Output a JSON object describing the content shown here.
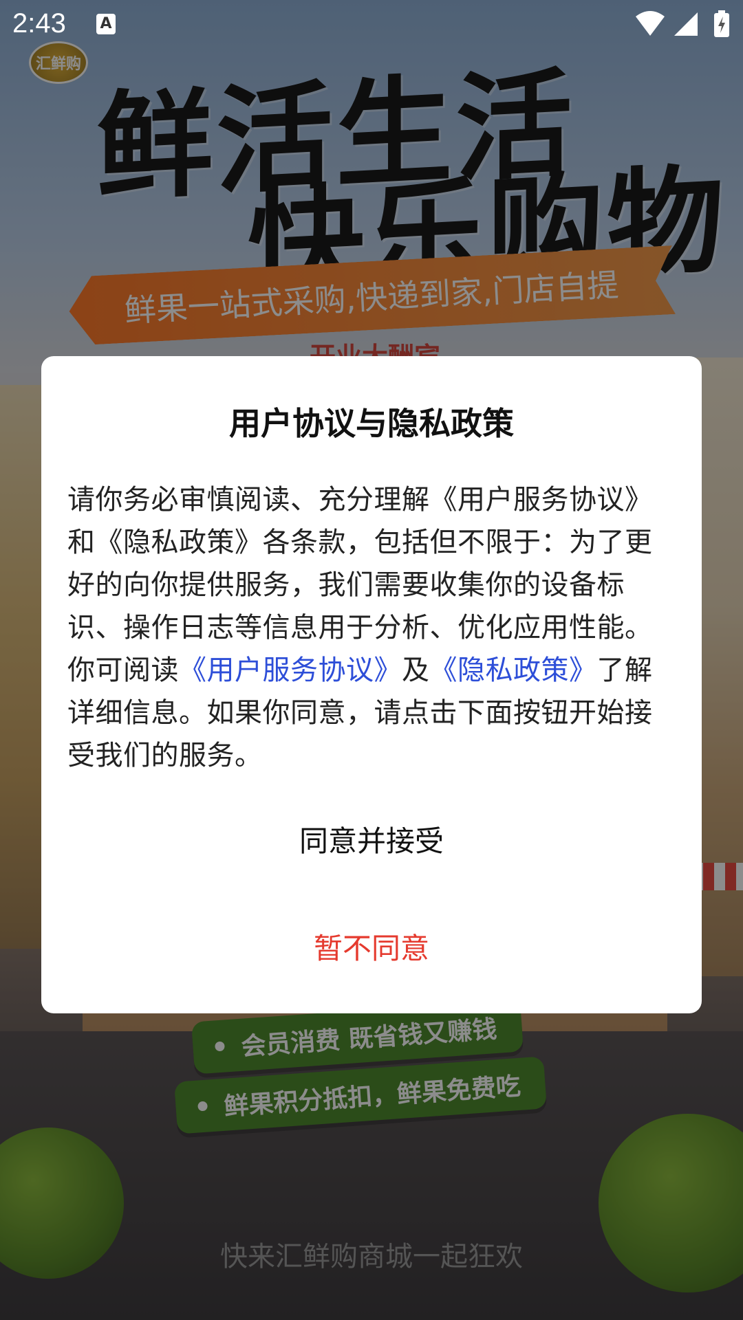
{
  "status_bar": {
    "time": "2:43",
    "notification_icon": "a-text-icon",
    "icons": [
      "wifi-icon",
      "cellular-signal-icon",
      "battery-charging-icon"
    ]
  },
  "splash": {
    "logo_text": "汇鲜购",
    "headline_1": "鲜活生活",
    "headline_2": "快乐购物",
    "ribbon": "鲜果一站式采购,快递到家,门店自提",
    "opening_tag": "开业大酬宾",
    "pill_1": "会员消费 既省钱又赚钱",
    "pill_2": "鲜果积分抵扣，鲜果免费吃",
    "bottom_slogan": "快来汇鲜购商城一起狂欢"
  },
  "dialog": {
    "title": "用户协议与隐私政策",
    "body_part1": "请你务必审慎阅读、充分理解《用户服务协议》和《隐私政策》各条款，包括但不限于：为了更好的向你提供服务，我们需要收集你的设备标识、操作日志等信息用于分析、优化应用性能。你可阅读",
    "link_terms": "《用户服务协议》",
    "body_and": "及",
    "link_privacy": "《隐私政策》",
    "body_part2": "了解详细信息。如果你同意，请点击下面按钮开始接受我们的服务。",
    "accept_label": "同意并接受",
    "decline_label": "暂不同意"
  },
  "colors": {
    "link": "#2d4ed8",
    "decline": "#e53a2e",
    "scrim": "rgba(0,0,0,0.45)"
  }
}
